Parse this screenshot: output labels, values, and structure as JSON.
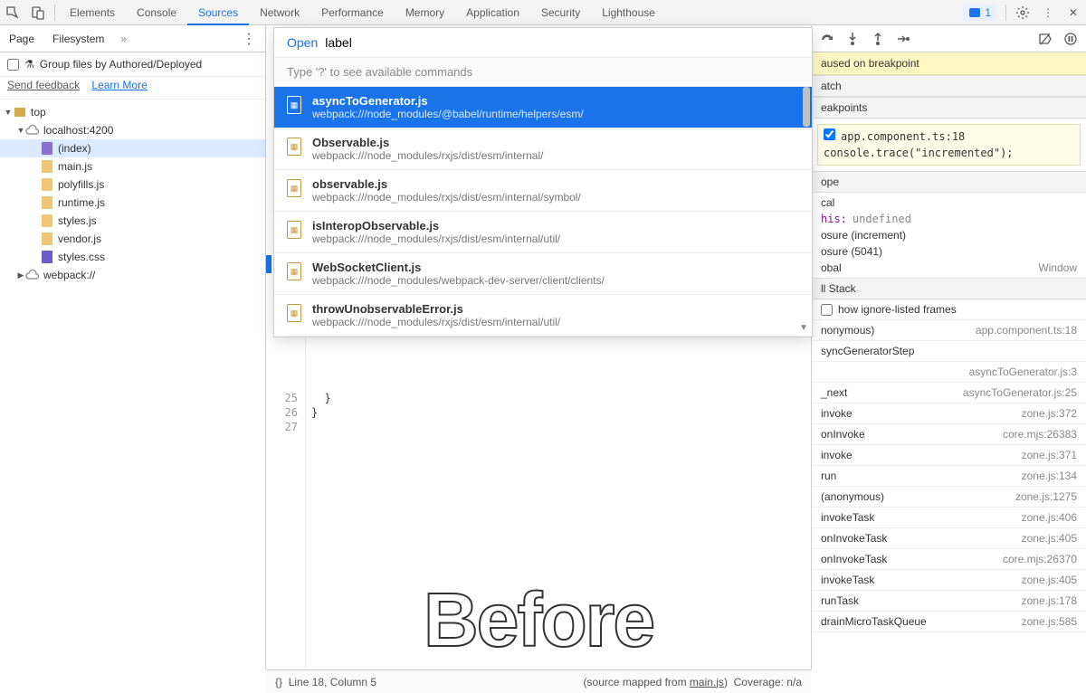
{
  "topTabs": {
    "items": [
      "Elements",
      "Console",
      "Sources",
      "Network",
      "Performance",
      "Memory",
      "Application",
      "Security",
      "Lighthouse"
    ],
    "activeIndex": 2,
    "badgeCount": "1"
  },
  "leftPane": {
    "subTabs": {
      "page": "Page",
      "filesystem": "Filesystem"
    },
    "groupLabel": "Group files by Authored/Deployed",
    "sendFeedback": "Send feedback",
    "learnMore": "Learn More",
    "tree": [
      {
        "lvl": 0,
        "arrow": "▼",
        "icon": "folder",
        "label": "top"
      },
      {
        "lvl": 1,
        "arrow": "▼",
        "icon": "cloud",
        "label": "localhost:4200"
      },
      {
        "lvl": 2,
        "arrow": "",
        "icon": "doc",
        "label": "(index)",
        "selected": true
      },
      {
        "lvl": 2,
        "arrow": "",
        "icon": "js",
        "label": "main.js"
      },
      {
        "lvl": 2,
        "arrow": "",
        "icon": "js",
        "label": "polyfills.js"
      },
      {
        "lvl": 2,
        "arrow": "",
        "icon": "js",
        "label": "runtime.js"
      },
      {
        "lvl": 2,
        "arrow": "",
        "icon": "js",
        "label": "styles.js"
      },
      {
        "lvl": 2,
        "arrow": "",
        "icon": "js",
        "label": "vendor.js"
      },
      {
        "lvl": 2,
        "arrow": "",
        "icon": "css",
        "label": "styles.css"
      },
      {
        "lvl": 1,
        "arrow": "▶",
        "icon": "cloud",
        "label": "webpack://"
      }
    ]
  },
  "code": {
    "startLine": 25,
    "lines": [
      "  }",
      "}",
      ""
    ],
    "before": "Before"
  },
  "popup": {
    "openLabel": "Open",
    "query": "label",
    "hint": "Type '?' to see available commands",
    "items": [
      {
        "title": "asyncToGenerator.js",
        "path": "webpack:///node_modules/@babel/runtime/helpers/esm/",
        "selected": true
      },
      {
        "title": "Observable.js",
        "path": "webpack:///node_modules/rxjs/dist/esm/internal/"
      },
      {
        "title": "observable.js",
        "path": "webpack:///node_modules/rxjs/dist/esm/internal/symbol/"
      },
      {
        "title": "isInteropObservable.js",
        "path": "webpack:///node_modules/rxjs/dist/esm/internal/util/"
      },
      {
        "title": "WebSocketClient.js",
        "path": "webpack:///node_modules/webpack-dev-server/client/clients/"
      },
      {
        "title": "throwUnobservableError.js",
        "path": "webpack:///node_modules/rxjs/dist/esm/internal/util/"
      }
    ]
  },
  "debugger": {
    "pausedMsg": "aused on breakpoint",
    "watch": "atch",
    "breakpoints": "eakpoints",
    "bp": {
      "loc": "app.component.ts:18",
      "code": "console.trace(\"incremented\");"
    },
    "scope": "ope",
    "scopeRows": {
      "local": "cal",
      "thisLabel": "his:",
      "thisVal": "undefined",
      "closure1": "osure (increment)",
      "closure2": "osure (5041)",
      "global": "obal",
      "globalVal": "Window"
    },
    "callStack": "ll Stack",
    "ignoreFrames": "how ignore-listed frames",
    "stack": [
      {
        "fn": "nonymous)",
        "loc": "app.component.ts:18"
      },
      {
        "fn": "syncGeneratorStep",
        "loc": ""
      },
      {
        "fn": "",
        "loc": "asyncToGenerator.js:3"
      },
      {
        "fn": "_next",
        "loc": "asyncToGenerator.js:25"
      },
      {
        "fn": "invoke",
        "loc": "zone.js:372"
      },
      {
        "fn": "onInvoke",
        "loc": "core.mjs:26383"
      },
      {
        "fn": "invoke",
        "loc": "zone.js:371"
      },
      {
        "fn": "run",
        "loc": "zone.js:134"
      },
      {
        "fn": "(anonymous)",
        "loc": "zone.js:1275"
      },
      {
        "fn": "invokeTask",
        "loc": "zone.js:406"
      },
      {
        "fn": "onInvokeTask",
        "loc": "zone.js:405"
      },
      {
        "fn": "onInvokeTask",
        "loc": "core.mjs:26370"
      },
      {
        "fn": "invokeTask",
        "loc": "zone.js:405"
      },
      {
        "fn": "runTask",
        "loc": "zone.js:178"
      },
      {
        "fn": "drainMicroTaskQueue",
        "loc": "zone.js:585"
      }
    ]
  },
  "statusBar": {
    "braces": "{}",
    "position": "Line 18, Column 5",
    "mappedPrefix": "(source mapped from ",
    "mappedFile": "main.js",
    "mappedSuffix": ")",
    "coverage": "Coverage: n/a"
  }
}
